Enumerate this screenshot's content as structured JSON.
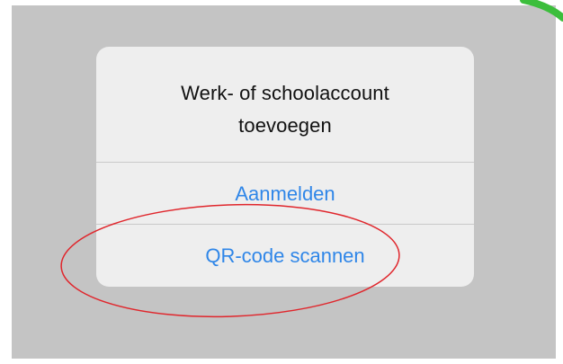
{
  "dialog": {
    "title_line1": "Werk- of schoolaccount",
    "title_line2": "toevoegen",
    "actions": [
      {
        "label": "Aanmelden"
      },
      {
        "label": "QR-code scannen"
      }
    ]
  },
  "colors": {
    "overlay": "#c4c4c4",
    "dialog_bg": "#eeeeee",
    "action_text": "#2f86e8",
    "highlight_ellipse": "#e0262c",
    "corner_decoration": "#3cbe3c"
  }
}
